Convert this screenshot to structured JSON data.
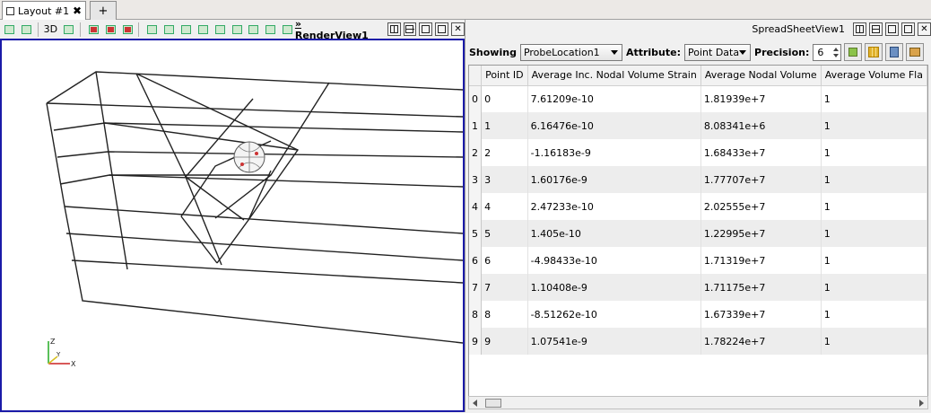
{
  "tabs": {
    "layout_label": "Layout #1",
    "close_glyph": "✖",
    "add_glyph": "+"
  },
  "render_view": {
    "toolbar_3d_label": "3D",
    "title_chevron": "»",
    "title": "RenderView1",
    "axis_labels": {
      "z": "Z",
      "y": "Y",
      "x": "X"
    }
  },
  "spreadsheet_view": {
    "title": "SpreadSheetView1",
    "showing_label": "Showing",
    "showing_value": "ProbeLocation1",
    "attribute_label": "Attribute:",
    "attribute_value": "Point Data",
    "precision_label": "Precision:",
    "precision_value": "6",
    "columns": [
      "Point ID",
      "Average Inc. Nodal Volume Strain",
      "Average Nodal Volume",
      "Average Volume Fla"
    ],
    "rows": [
      {
        "idx": "0",
        "point_id": "0",
        "strain": "7.61209e-10",
        "volume": "1.81939e+7",
        "flag": "1"
      },
      {
        "idx": "1",
        "point_id": "1",
        "strain": "6.16476e-10",
        "volume": "8.08341e+6",
        "flag": "1"
      },
      {
        "idx": "2",
        "point_id": "2",
        "strain": "-1.16183e-9",
        "volume": "1.68433e+7",
        "flag": "1"
      },
      {
        "idx": "3",
        "point_id": "3",
        "strain": "1.60176e-9",
        "volume": "1.77707e+7",
        "flag": "1"
      },
      {
        "idx": "4",
        "point_id": "4",
        "strain": "2.47233e-10",
        "volume": "2.02555e+7",
        "flag": "1"
      },
      {
        "idx": "5",
        "point_id": "5",
        "strain": "1.405e-10",
        "volume": "1.22995e+7",
        "flag": "1"
      },
      {
        "idx": "6",
        "point_id": "6",
        "strain": "-4.98433e-10",
        "volume": "1.71319e+7",
        "flag": "1"
      },
      {
        "idx": "7",
        "point_id": "7",
        "strain": "1.10408e-9",
        "volume": "1.71175e+7",
        "flag": "1"
      },
      {
        "idx": "8",
        "point_id": "8",
        "strain": "-8.51262e-10",
        "volume": "1.67339e+7",
        "flag": "1"
      },
      {
        "idx": "9",
        "point_id": "9",
        "strain": "1.07541e-9",
        "volume": "1.78224e+7",
        "flag": "1"
      }
    ]
  },
  "pane_buttons": {
    "close_glyph": "✕"
  },
  "colors": {
    "active_view_border": "#1a1aa8",
    "row_alt": "#ededed"
  }
}
